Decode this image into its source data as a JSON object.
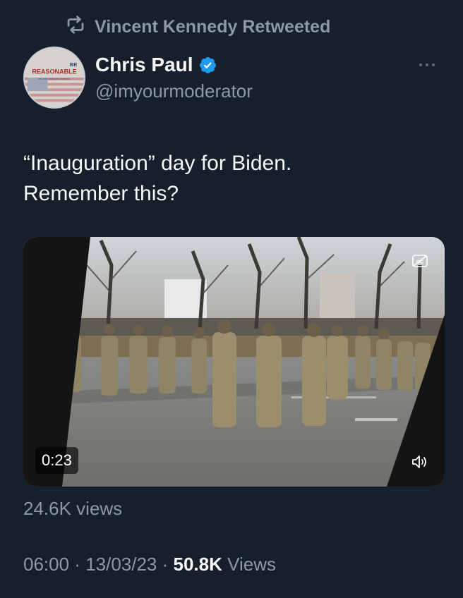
{
  "retweet": {
    "label": "Vincent Kennedy Retweeted",
    "icon": "retweet-icon"
  },
  "author": {
    "avatar_text": {
      "line1": "BE",
      "line2": "REASONABLE",
      "line3": "WITH YOUR MODERATOR CHRIS PAUL"
    },
    "display_name": "Chris Paul",
    "verified_icon": "verified-badge-icon",
    "handle": "@imyourmoderator"
  },
  "tweet": {
    "text_line1": "“Inauguration” day for Biden.",
    "text_line2": "Remember this?"
  },
  "video": {
    "duration": "0:23",
    "captions_icon": "closed-captions-icon",
    "volume_icon": "volume-icon",
    "views": "24.6K views"
  },
  "meta": {
    "time": "06:00",
    "sep1": " · ",
    "date": "13/03/23",
    "sep2": " · ",
    "views_count": "50.8K",
    "views_label": " Views"
  },
  "colors": {
    "background": "#15202b",
    "muted_text": "#8b98a5",
    "primary_text": "#f7f9f9",
    "verified_blue": "#1d9bf0"
  }
}
